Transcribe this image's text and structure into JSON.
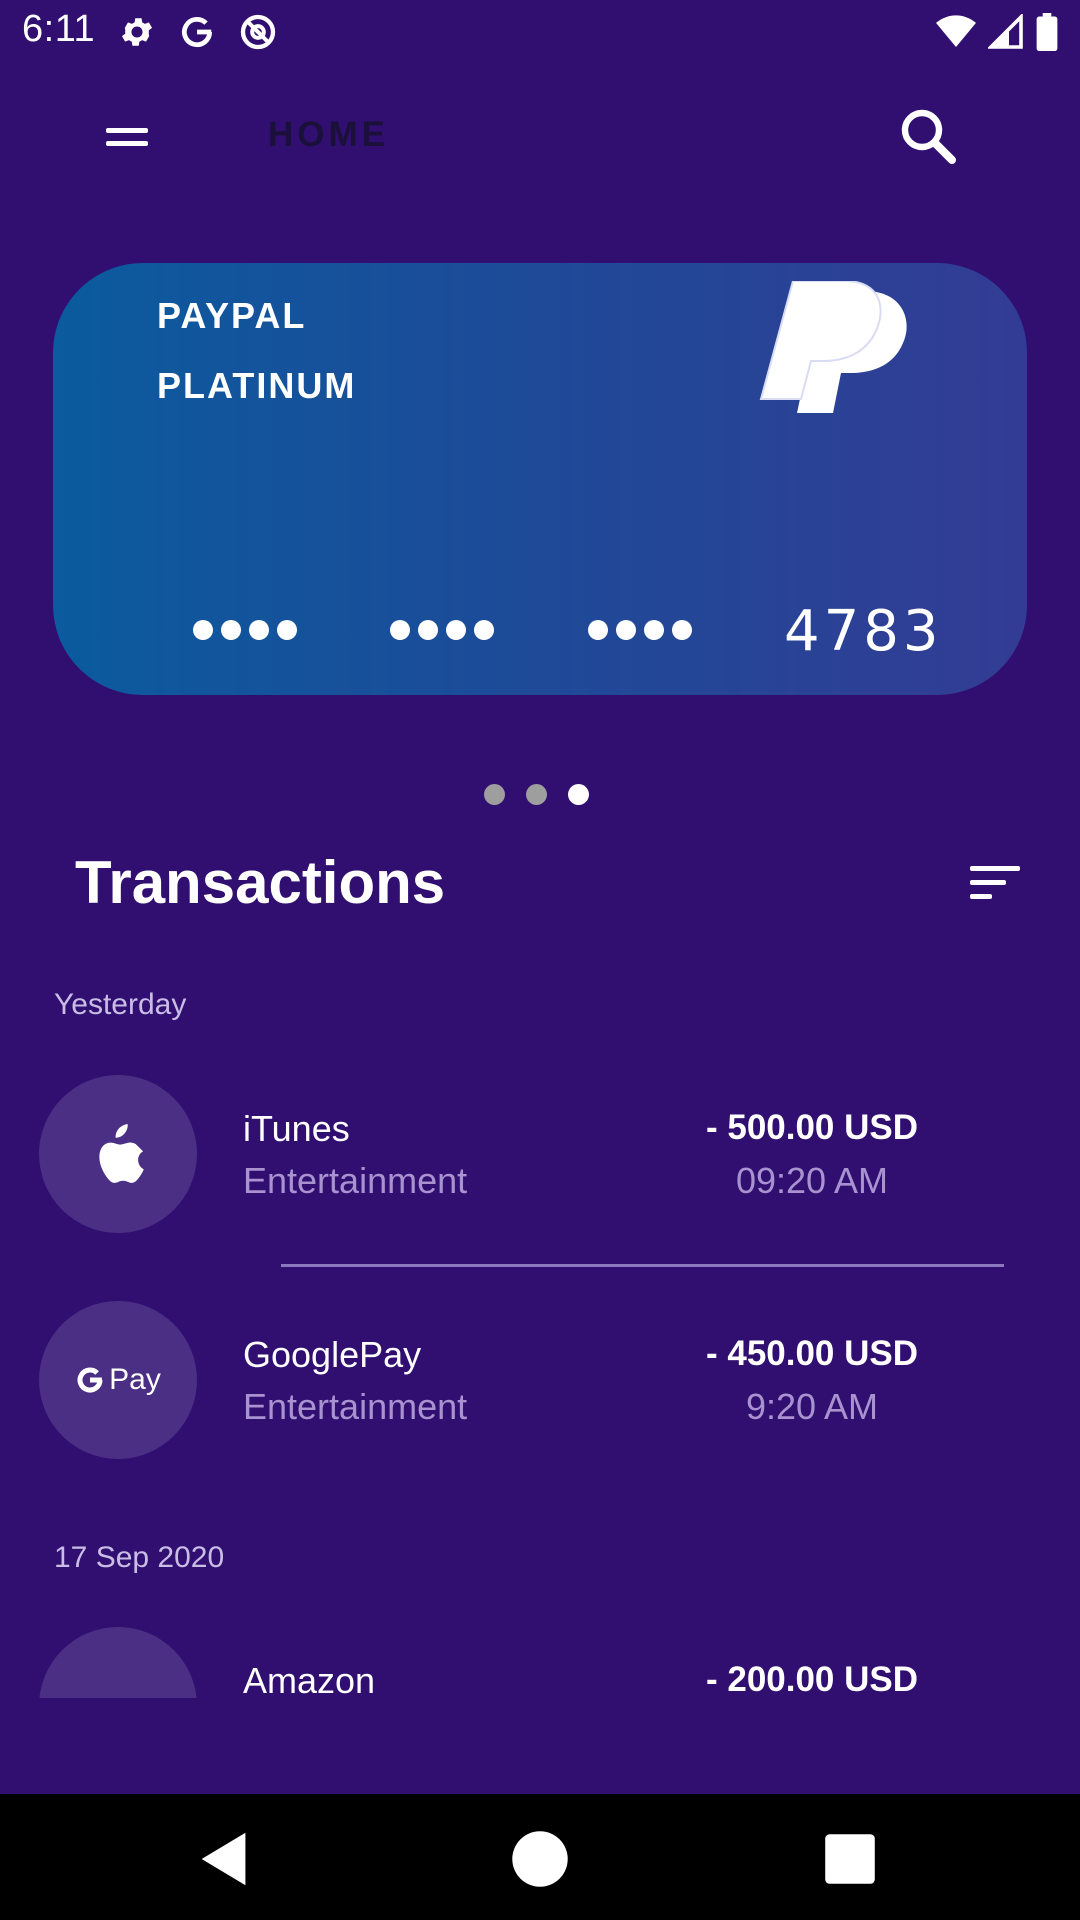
{
  "status_bar": {
    "time": "6:11",
    "left_icons": [
      "gear-icon",
      "google-g-icon",
      "at-sign-icon"
    ],
    "right_icons": [
      "wifi-icon",
      "cell-signal-icon",
      "battery-icon"
    ]
  },
  "app_bar": {
    "title": "HOME",
    "menu_icon": "hamburger-menu-icon",
    "search_icon": "search-icon"
  },
  "card": {
    "brand": "PAYPAL",
    "type": "PLATINUM",
    "logo": "paypal-logo",
    "masked_groups": [
      "●●●●",
      "●●●●",
      "●●●●"
    ],
    "last4": "4783",
    "gradient": [
      "#0b5b9e",
      "#333c94"
    ]
  },
  "pager": {
    "count": 3,
    "active_index": 2,
    "active_color": "#ffffff",
    "inactive_color": "#9e9e9e"
  },
  "transactions": {
    "title": "Transactions",
    "filter_icon": "sort-filter-icon",
    "sections": [
      {
        "label": "Yesterday",
        "items": [
          {
            "name": "iTunes",
            "category": "Entertainment",
            "amount": "- 500.00 USD",
            "time": "09:20 AM",
            "icon": "apple-icon"
          },
          {
            "name": "GooglePay",
            "category": "Entertainment",
            "amount": "- 450.00 USD",
            "time": "9:20 AM",
            "icon": "gpay-icon",
            "icon_text": "Pay"
          }
        ]
      },
      {
        "label": "17 Sep 2020",
        "items": [
          {
            "name": "Amazon",
            "amount": "- 200.00 USD",
            "icon": "amazon-icon"
          }
        ]
      }
    ]
  },
  "nav_bar": {
    "buttons": [
      "back-icon",
      "home-icon",
      "recents-icon"
    ]
  },
  "colors": {
    "background": "#300f70",
    "icon_circle": "#4a2f85",
    "muted_text": "#a892cf",
    "section_label": "#c9bde6"
  }
}
